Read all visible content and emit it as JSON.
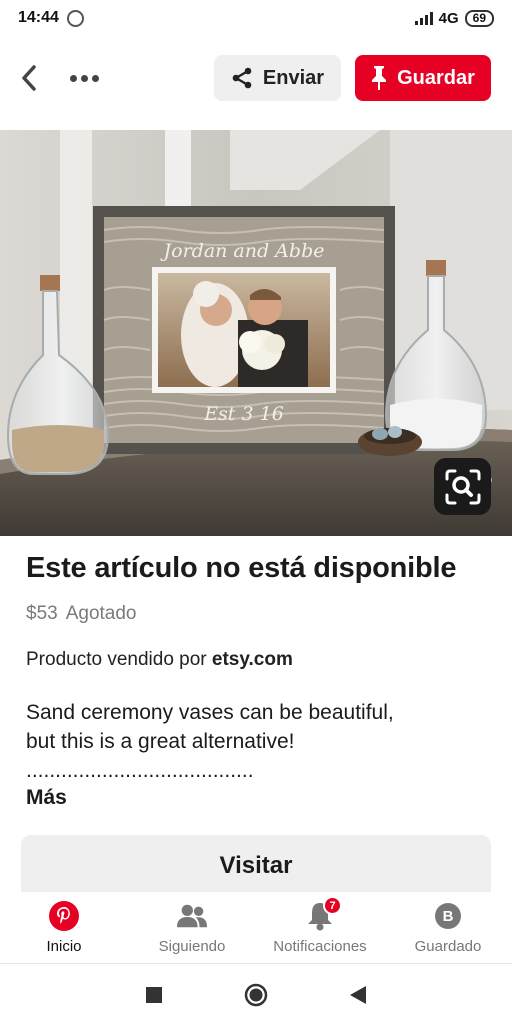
{
  "status_bar": {
    "time": "14:44",
    "network": "4G",
    "battery": "69"
  },
  "header": {
    "share_label": "Enviar",
    "save_label": "Guardar"
  },
  "pin": {
    "title": "Este artículo no está disponible",
    "price": "$53",
    "availability": "Agotado",
    "vendor_prefix": "Producto vendido por",
    "vendor": "etsy.com",
    "description": "Sand ceremony vases can be beautiful, but this is a great alternative! .......................................",
    "more_label": "Más",
    "visit_label": "Visitar",
    "image_frame_text_top": "Jordan and Abbe",
    "image_frame_text_bottom": "Est 3 16"
  },
  "bottom_nav": {
    "items": [
      {
        "label": "Inicio",
        "icon": "pinterest-icon"
      },
      {
        "label": "Siguiendo",
        "icon": "people-icon"
      },
      {
        "label": "Notificaciones",
        "icon": "bell-icon",
        "badge": "7"
      },
      {
        "label": "Guardado",
        "icon": "profile-icon",
        "avatar_letter": "B"
      }
    ]
  },
  "colors": {
    "brand_red": "#e60023",
    "button_gray": "#efefef"
  }
}
